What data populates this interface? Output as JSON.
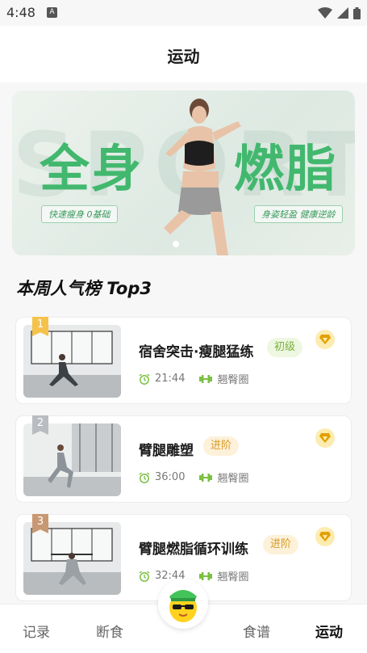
{
  "status_bar": {
    "time": "4:48",
    "app_icon": "A"
  },
  "header": {
    "title": "运动"
  },
  "banner": {
    "big_left": "全身",
    "big_right": "燃脂",
    "watermark": "SPORT",
    "tag_left": "快速瘦身  0基础",
    "tag_right": "身姿轻盈  健康逆龄"
  },
  "section": {
    "title": "本周人气榜 Top3"
  },
  "workouts": [
    {
      "rank": "1",
      "title": "宿舍突击·瘦腿猛练",
      "level": "初级",
      "duration": "21:44",
      "tag": "翘臀圈",
      "rank_color": "#f5c24a"
    },
    {
      "rank": "2",
      "title": "臂腿雕塑",
      "level": "进阶",
      "duration": "36:00",
      "tag": "翘臀圈",
      "rank_color": "#b9bcc0"
    },
    {
      "rank": "3",
      "title": "臂腿燃脂循环训练",
      "level": "进阶",
      "duration": "32:44",
      "tag": "翘臀圈",
      "rank_color": "#c89873"
    }
  ],
  "tabs": [
    "记录",
    "断食",
    "食谱",
    "运动"
  ],
  "colors": {
    "accent": "#42b86e",
    "gold": "#f2c230"
  }
}
